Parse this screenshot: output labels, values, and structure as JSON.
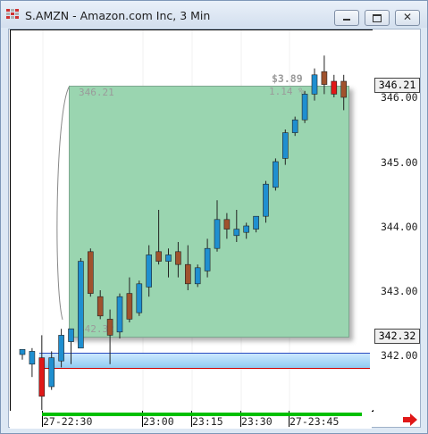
{
  "window": {
    "title": "S.AMZN - Amazon.com Inc, 3 Min",
    "minimize_label": "minimize",
    "maximize_label": "maximize",
    "close_label": "close"
  },
  "price_axis": {
    "ticks": [
      "346.00",
      "345.00",
      "344.00",
      "343.00",
      "342.00"
    ],
    "last_price": "346.21",
    "reference_price": "342.32"
  },
  "time_axis": {
    "labels": [
      "27-22:30",
      "23:00",
      "23:15",
      "23:30",
      "27-23:45"
    ]
  },
  "measure": {
    "start_price": "346.21",
    "end_price": "342.32",
    "change": "$3.89",
    "change_percent": "1.14 %"
  },
  "chart_data": {
    "type": "candlestick",
    "symbol": "S.AMZN",
    "interval": "3 Min",
    "ylim": [
      341.2,
      346.75
    ],
    "candles": [
      {
        "o": 342.0,
        "h": 342.08,
        "l": 341.92,
        "c": 342.08
      },
      {
        "o": 341.85,
        "h": 342.1,
        "l": 341.65,
        "c": 342.05
      },
      {
        "o": 341.95,
        "h": 342.3,
        "l": 340.9,
        "c": 341.35
      },
      {
        "o": 341.5,
        "h": 342.05,
        "l": 341.45,
        "c": 341.95
      },
      {
        "o": 341.9,
        "h": 342.4,
        "l": 341.8,
        "c": 342.3
      },
      {
        "o": 342.2,
        "h": 342.4,
        "l": 341.85,
        "c": 342.4
      },
      {
        "o": 342.1,
        "h": 343.5,
        "l": 342.1,
        "c": 343.45
      },
      {
        "o": 343.6,
        "h": 343.65,
        "l": 342.9,
        "c": 342.95
      },
      {
        "o": 342.9,
        "h": 343.0,
        "l": 342.55,
        "c": 342.6
      },
      {
        "o": 342.55,
        "h": 342.7,
        "l": 341.85,
        "c": 342.3
      },
      {
        "o": 342.35,
        "h": 342.95,
        "l": 342.25,
        "c": 342.9
      },
      {
        "o": 342.95,
        "h": 343.2,
        "l": 342.5,
        "c": 342.55
      },
      {
        "o": 342.65,
        "h": 343.15,
        "l": 342.6,
        "c": 343.1
      },
      {
        "o": 343.05,
        "h": 343.7,
        "l": 342.9,
        "c": 343.55
      },
      {
        "o": 343.6,
        "h": 344.25,
        "l": 343.4,
        "c": 343.45
      },
      {
        "o": 343.45,
        "h": 343.65,
        "l": 343.2,
        "c": 343.55
      },
      {
        "o": 343.6,
        "h": 343.75,
        "l": 343.2,
        "c": 343.4
      },
      {
        "o": 343.4,
        "h": 343.7,
        "l": 343.0,
        "c": 343.1
      },
      {
        "o": 343.1,
        "h": 343.4,
        "l": 343.05,
        "c": 343.35
      },
      {
        "o": 343.3,
        "h": 343.8,
        "l": 343.2,
        "c": 343.65
      },
      {
        "o": 343.65,
        "h": 344.4,
        "l": 343.6,
        "c": 344.1
      },
      {
        "o": 344.1,
        "h": 344.2,
        "l": 343.8,
        "c": 343.95
      },
      {
        "o": 343.85,
        "h": 344.25,
        "l": 343.75,
        "c": 343.95
      },
      {
        "o": 343.9,
        "h": 344.05,
        "l": 343.8,
        "c": 344.0
      },
      {
        "o": 343.95,
        "h": 344.15,
        "l": 343.9,
        "c": 344.15
      },
      {
        "o": 344.15,
        "h": 344.7,
        "l": 344.05,
        "c": 344.65
      },
      {
        "o": 344.6,
        "h": 345.05,
        "l": 344.55,
        "c": 345.0
      },
      {
        "o": 345.05,
        "h": 345.5,
        "l": 344.95,
        "c": 345.45
      },
      {
        "o": 345.45,
        "h": 345.7,
        "l": 345.4,
        "c": 345.65
      },
      {
        "o": 345.65,
        "h": 346.1,
        "l": 345.6,
        "c": 346.05
      },
      {
        "o": 346.05,
        "h": 346.45,
        "l": 345.95,
        "c": 346.35
      },
      {
        "o": 346.4,
        "h": 346.65,
        "l": 346.05,
        "c": 346.2
      },
      {
        "o": 346.25,
        "h": 346.35,
        "l": 346.0,
        "c": 346.05
      },
      {
        "o": 346.25,
        "h": 346.35,
        "l": 345.8,
        "c": 346.0
      }
    ]
  },
  "colors": {
    "up": "#1f8fd0",
    "down": "#a0522d",
    "highlight_up": "#e01818",
    "measure_fill": "#9ad5b0",
    "session_bar": "#00c000"
  },
  "icons": {
    "app": "grid-app-icon",
    "scroll": "right-arrow-icon"
  }
}
